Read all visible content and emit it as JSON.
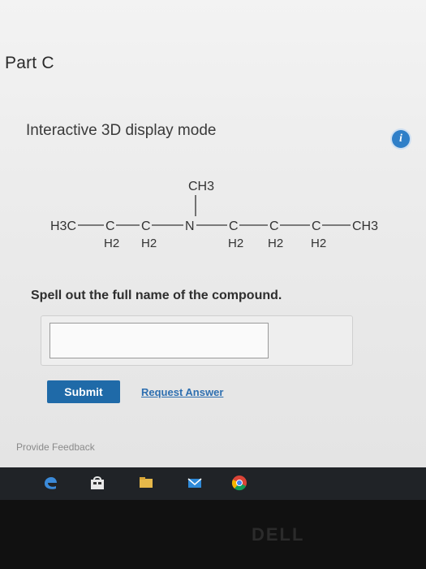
{
  "part": {
    "title": "Part C"
  },
  "display_mode": {
    "text": "Interactive 3D display mode",
    "info_icon": "info-icon"
  },
  "molecule": {
    "methyl_top": "CH3",
    "left_end": "H3C",
    "carbon": "C",
    "nitrogen": "N",
    "right_end": "CH3",
    "h2": "H2"
  },
  "question": {
    "text": "Spell out the full name of the compound."
  },
  "answer": {
    "value": "",
    "placeholder": ""
  },
  "buttons": {
    "submit": "Submit",
    "request_answer": "Request Answer"
  },
  "feedback": {
    "label": "Provide Feedback"
  },
  "taskbar": {
    "icons": [
      "edge-icon",
      "store-icon",
      "file-explorer-icon",
      "mail-icon",
      "chrome-icon"
    ]
  },
  "brand": "DELL",
  "colors": {
    "submit_bg": "#1f6aa8",
    "link": "#2e6fb0",
    "info": "#2f7fc8"
  }
}
